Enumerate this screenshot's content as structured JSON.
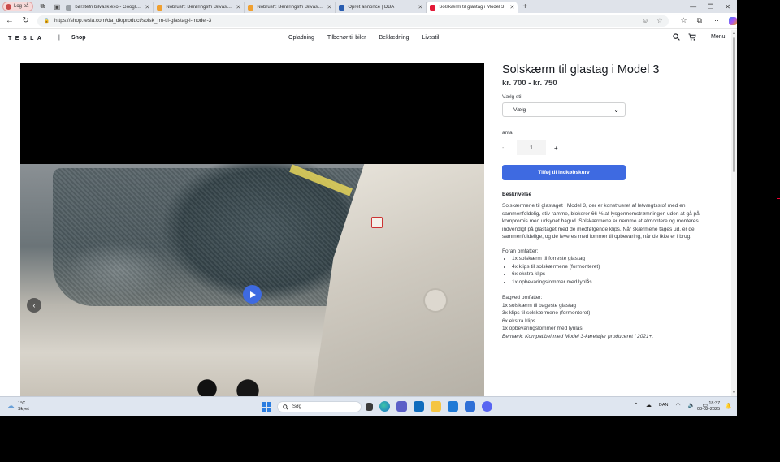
{
  "browser": {
    "profile_label": "Log på",
    "tabs": [
      {
        "title": "børstefri bilvask exo - Google-søgning",
        "fav_color": "#9aa0a6"
      },
      {
        "title": "Nobrush: Berøringsfri Bilvask - Hurtig",
        "fav_color": "#f0a030"
      },
      {
        "title": "Nobrush: Berøringsfri Bilvask - Hurtig",
        "fav_color": "#f0a030"
      },
      {
        "title": "Opret annonce | DBA",
        "fav_color": "#2a5db0"
      },
      {
        "title": "Solskærm til glastag i Model 3",
        "fav_color": "#e31937"
      }
    ],
    "url": "https://shop.tesla.com/da_dk/product/solsk_rm-til-glastag-i-model-3"
  },
  "site": {
    "logo": "TESLA",
    "separator": "|",
    "shop": "Shop",
    "nav": [
      "Opladning",
      "Tilbehør til biler",
      "Beklædning",
      "Livsstil"
    ],
    "menu_label": "Menu"
  },
  "product": {
    "title": "Solskærm til glastag i Model 3",
    "price": "kr. 700 - kr. 750",
    "style_label": "Vælg stil",
    "style_value": "- Vælg -",
    "qty_label": "antal",
    "qty_minus": "-",
    "qty_value": "1",
    "qty_plus": "+",
    "cta": "Tilføj til indkøbskurv",
    "desc_title": "Beskrivelse",
    "desc": "Solskærmene til glastaget i Model 3, der er konstrueret af letvægtsstof med en sammenfoldelig, stiv ramme, blokerer 66 % af lysgennemstrømningen uden at gå på kompromis med udsynet bagud. Solskærmene er nemme at afmontere og monteres indvendigt på glastaget med de medfølgende klips. Når skærmene tages ud, er de sammenfoldelige, og de leveres med lommer til opbevaring, når de ikke er i brug.",
    "front_title": "Foran omfatter:",
    "front_items": [
      "1x solskærm til forreste glastag",
      "4x klips til solskærmene (formonteret)",
      "6x ekstra klips",
      "1x opbevaringslommer med lynlås"
    ],
    "rear_title": "Bagved omfatter:",
    "rear_items": [
      "1x solskærm til bageste glastag",
      "3x klips til solskærmene (formonteret)",
      "6x ekstra klips",
      "1x opbevaringslommer med lynlås"
    ],
    "note": "Bemærk: Kompatibel med Model 3-køretøjer produceret i 2021+."
  },
  "taskbar": {
    "temp": "1°C",
    "weather": "Skyet",
    "search_placeholder": "Søg",
    "lang": "DAN",
    "time": "18:37",
    "date": "08-02-2025"
  },
  "colors": {
    "accent": "#3e6ae1",
    "tesla_red": "#e31937",
    "text": "#171a20"
  }
}
